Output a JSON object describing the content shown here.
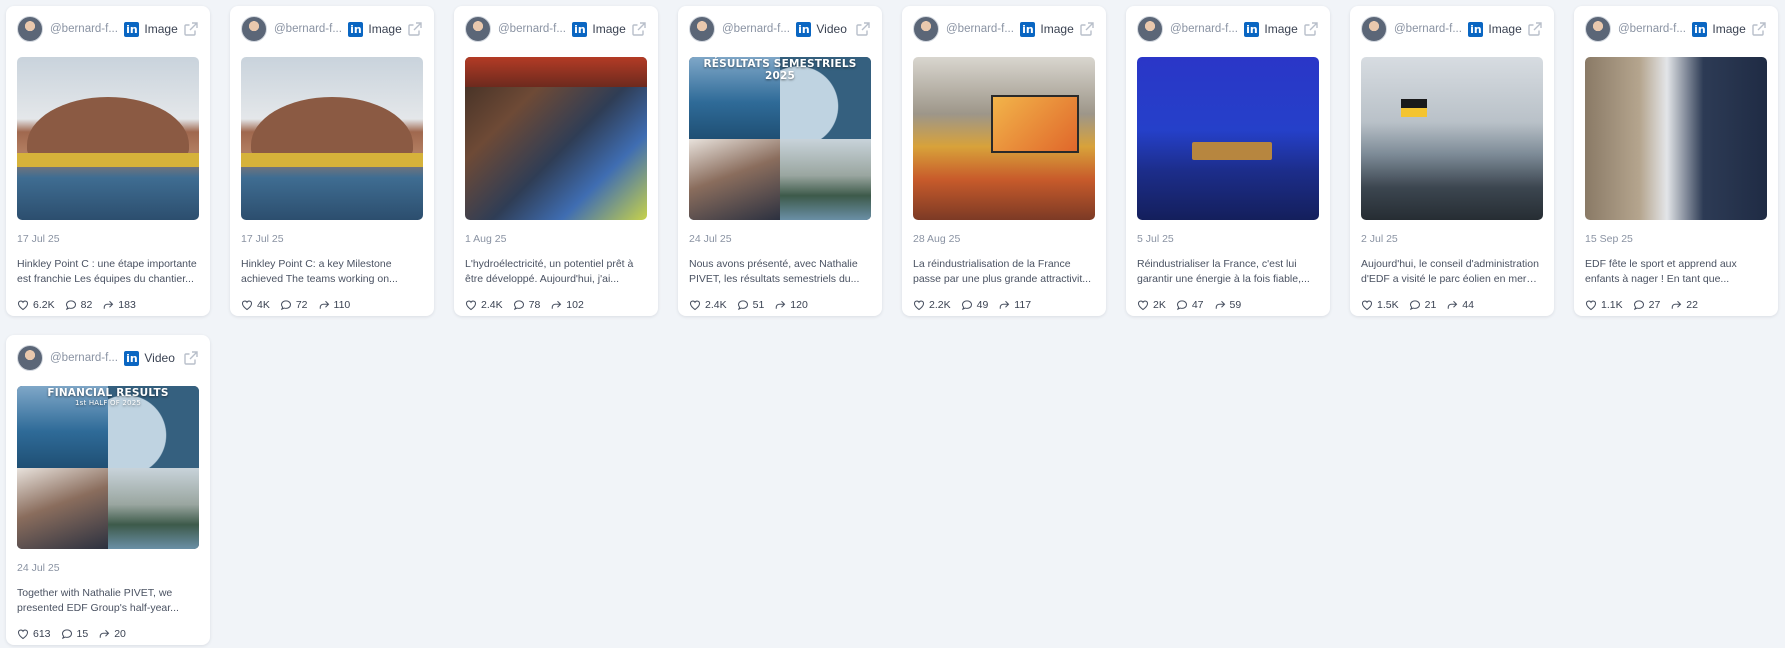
{
  "colors": {
    "background": "#f1f4f8",
    "linkedin": "#0a66c2",
    "muted_text": "#8a93a3"
  },
  "icons": {
    "platform": "linkedin-icon",
    "external": "external-link-icon",
    "likes": "heart-icon",
    "comments": "comment-icon",
    "shares": "share-icon"
  },
  "posts": [
    {
      "handle": "@bernard-f...",
      "platform_letters": "in",
      "type": "Image",
      "date": "17 Jul 25",
      "text": "Hinkley Point C : une étape importante est franchie Les équipes du chantier...",
      "likes": "6.2K",
      "comments": "82",
      "shares": "183",
      "media_style": "dome"
    },
    {
      "handle": "@bernard-f...",
      "platform_letters": "in",
      "type": "Image",
      "date": "17 Jul 25",
      "text": "Hinkley Point C: a key Milestone achieved The teams working on...",
      "likes": "4K",
      "comments": "72",
      "shares": "110",
      "media_style": "dome"
    },
    {
      "handle": "@bernard-f...",
      "platform_letters": "in",
      "type": "Image",
      "date": "1 Aug 25",
      "text": "L'hydroélectricité, un potentiel prêt à être développé. Aujourd'hui, j'ai...",
      "likes": "2.4K",
      "comments": "78",
      "shares": "102",
      "media_style": "hydro"
    },
    {
      "handle": "@bernard-f...",
      "platform_letters": "in",
      "type": "Video",
      "date": "24 Jul 25",
      "text": "Nous avons présenté, avec Nathalie PIVET, les résultats semestriels du...",
      "likes": "2.4K",
      "comments": "51",
      "shares": "120",
      "media_style": "results",
      "media_caption": "RÉSULTATS SEMESTRIELS 2025"
    },
    {
      "handle": "@bernard-f...",
      "platform_letters": "in",
      "type": "Image",
      "date": "28 Aug 25",
      "text": "La réindustrialisation de la France passe par une plus grande attractivit...",
      "likes": "2.2K",
      "comments": "49",
      "shares": "117",
      "media_style": "stage"
    },
    {
      "handle": "@bernard-f...",
      "platform_letters": "in",
      "type": "Image",
      "date": "5 Jul 25",
      "text": "Réindustrialiser la France, c'est lui garantir une énergie à la fois fiable,...",
      "likes": "2K",
      "comments": "47",
      "shares": "59",
      "media_style": "panel"
    },
    {
      "handle": "@bernard-f...",
      "platform_letters": "in",
      "type": "Image",
      "date": "2 Jul 25",
      "text": "Aujourd'hui, le conseil d'administration d'EDF a visité le parc éolien en mer de...",
      "likes": "1.5K",
      "comments": "21",
      "shares": "44",
      "media_style": "boat"
    },
    {
      "handle": "@bernard-f...",
      "platform_letters": "in",
      "type": "Image",
      "date": "15 Sep 25",
      "text": "EDF fête le sport et apprend aux enfants à nager !      En tant que...",
      "likes": "1.1K",
      "comments": "27",
      "shares": "22",
      "media_style": "kids"
    },
    {
      "handle": "@bernard-f...",
      "platform_letters": "in",
      "type": "Video",
      "date": "24 Jul 25",
      "text": "Together with Nathalie PIVET, we presented EDF Group's half-year...",
      "likes": "613",
      "comments": "15",
      "shares": "20",
      "media_style": "financial",
      "media_caption": "FINANCIAL RESULTS",
      "media_subcaption": "1st HALF OF 2025"
    }
  ]
}
